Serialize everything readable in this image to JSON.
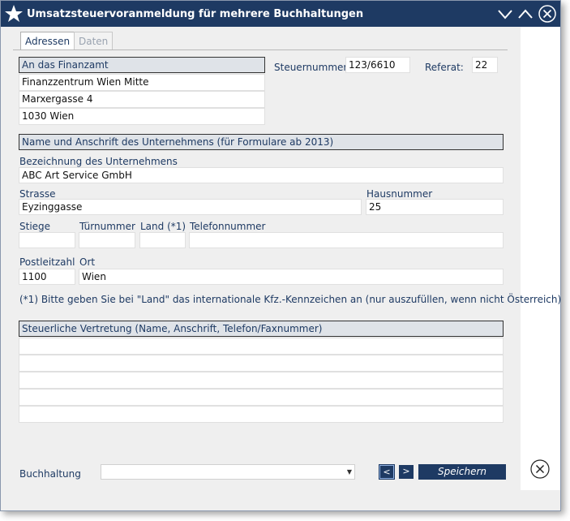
{
  "window": {
    "title": "Umsatzsteuervoranmeldung für mehrere Buchhaltungen",
    "colors": {
      "titlebar": "#1e3a63",
      "accent": "#1e3a63",
      "background": "#efefef"
    }
  },
  "tabs": [
    {
      "label": "Adressen",
      "active": true
    },
    {
      "label": "Daten",
      "active": false
    }
  ],
  "finanzamt": {
    "header": "An das Finanzamt",
    "line1": "Finanzzentrum Wien Mitte",
    "line2": "Marxergasse 4",
    "line3": "1030 Wien"
  },
  "steuernummer": {
    "label": "Steuernummer:",
    "value": "123/6610"
  },
  "referat": {
    "label": "Referat:",
    "value": "22"
  },
  "unternehmen": {
    "header": "Name und Anschrift des Unternehmens (für Formulare ab 2013)",
    "bezeichnung_label": "Bezeichnung des Unternehmens",
    "bezeichnung_value": "ABC Art Service GmbH",
    "strasse_label": "Strasse",
    "strasse_value": "Eyzinggasse",
    "hausnummer_label": "Hausnummer",
    "hausnummer_value": "25",
    "stiege_label": "Stiege",
    "stiege_value": "",
    "tuernummer_label": "Türnummer",
    "tuernummer_value": "",
    "land_label": "Land (*1)",
    "land_value": "",
    "telefon_label": "Telefonnummer",
    "telefon_value": "",
    "plz_label": "Postleitzahl",
    "plz_value": "1100",
    "ort_label": "Ort",
    "ort_value": "Wien",
    "note": "(*1) Bitte geben Sie bei \"Land\" das internationale Kfz.-Kennzeichen an (nur auszufüllen, wenn nicht Österreich)"
  },
  "vertretung": {
    "header": "Steuerliche Vertretung (Name, Anschrift, Telefon/Faxnummer)",
    "lines": [
      "",
      "",
      "",
      "",
      ""
    ]
  },
  "footer": {
    "buchhaltung_label": "Buchhaltung",
    "buchhaltung_value": "",
    "prev_label": "<",
    "next_label": ">",
    "save_label": "Speichern"
  },
  "icons": {
    "app": "star-icon",
    "minimize": "chevron-down-icon",
    "maximize": "chevron-up-icon",
    "close": "close-icon",
    "panel_close": "close-circle-icon"
  }
}
